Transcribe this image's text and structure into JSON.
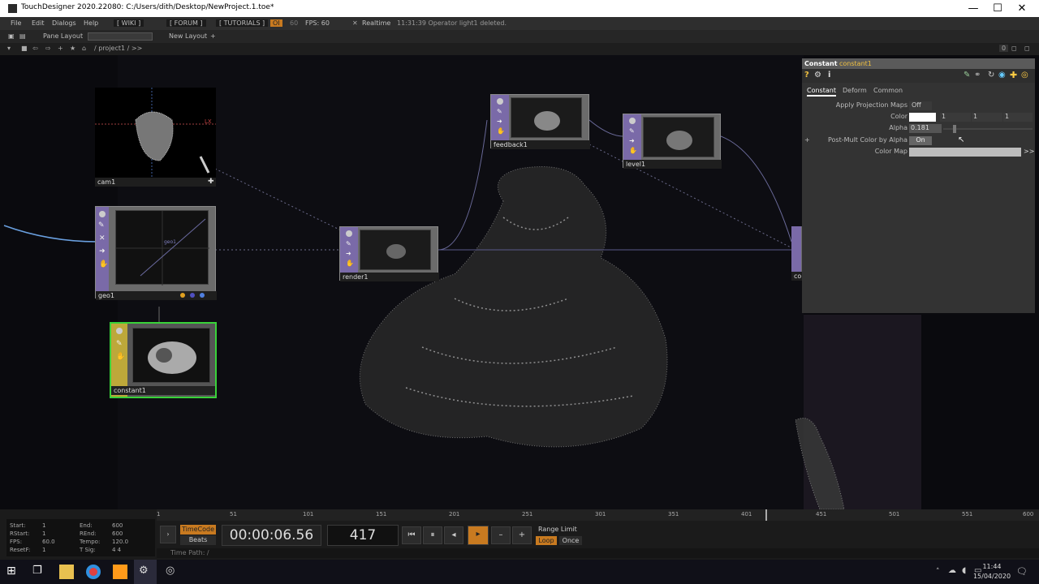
{
  "window": {
    "title": "TouchDesigner 2020.22080: C:/Users/dith/Desktop/NewProject.1.toe*",
    "minimize": "—",
    "maximize": "☐",
    "close": "✕"
  },
  "menubar": {
    "items": [
      "File",
      "Edit",
      "Dialogs",
      "Help"
    ],
    "wiki": "[ WIKI ]",
    "forum": "[ FORUM ]",
    "tutorials": "[ TUTORIALS ]",
    "oi": "OI",
    "num": "60",
    "fps": "FPS:  60",
    "realtime": "Realtime",
    "status": "11:31:39 Operator light1 deleted."
  },
  "panebar": {
    "pane_layout": "Pane Layout",
    "new_layout": "New Layout",
    "plus": "+"
  },
  "pathbar": {
    "path": "/ project1 / >>",
    "zero": "0"
  },
  "nodes": {
    "cam": "cam1",
    "geo": "geo1",
    "geo_preview_text": "geo1",
    "constant": "constant1",
    "render": "render1",
    "feedback": "feedback1",
    "level": "level1",
    "comp_partial": "co",
    "cam_axis_x": "LX",
    "cam_axis_y": "LY"
  },
  "params": {
    "op_type": "Constant",
    "op_name": "constant1",
    "tabs": [
      "Constant",
      "Deform",
      "Common"
    ],
    "rows": [
      {
        "label": "Apply Projection Maps",
        "value": "Off"
      },
      {
        "label": "Color",
        "r": "1",
        "g": "1",
        "b": "1"
      },
      {
        "label": "Alpha",
        "value": "0.181"
      },
      {
        "label": "Post-Mult Color by Alpha",
        "value": "On"
      },
      {
        "label": "Color Map",
        "value": ""
      }
    ],
    "expand": ">>",
    "plus": "+"
  },
  "timeline": {
    "ticks": [
      "1",
      "51",
      "101",
      "151",
      "201",
      "251",
      "301",
      "351",
      "401",
      "451",
      "501",
      "551",
      "600"
    ]
  },
  "info": {
    "start_label": "Start:",
    "start": "1",
    "end_label": "End:",
    "end": "600",
    "rstart_label": "RStart:",
    "rstart": "1",
    "rend_label": "REnd:",
    "rend": "600",
    "fps_label": "FPS:",
    "fps": "60.0",
    "tempo_label": "Tempo:",
    "tempo": "120.0",
    "resetf_label": "ResetF:",
    "resetf": "1",
    "tsig_label": "T Sig:",
    "tsig": "4    4"
  },
  "transport": {
    "timecode_btn": "TimeCode",
    "beats_btn": "Beats",
    "timecode": "00:00:06.56",
    "frame": "417",
    "range_limit": "Range Limit",
    "loop": "Loop",
    "once": "Once",
    "time_path": "Time Path: /"
  },
  "taskbar": {
    "time": "11:44",
    "date": "15/04/2020"
  },
  "colors": {
    "accent": "#f0c040",
    "selection": "#39d239",
    "top_strip": "#7a6aa8",
    "comp_strip": "#bda83a"
  }
}
